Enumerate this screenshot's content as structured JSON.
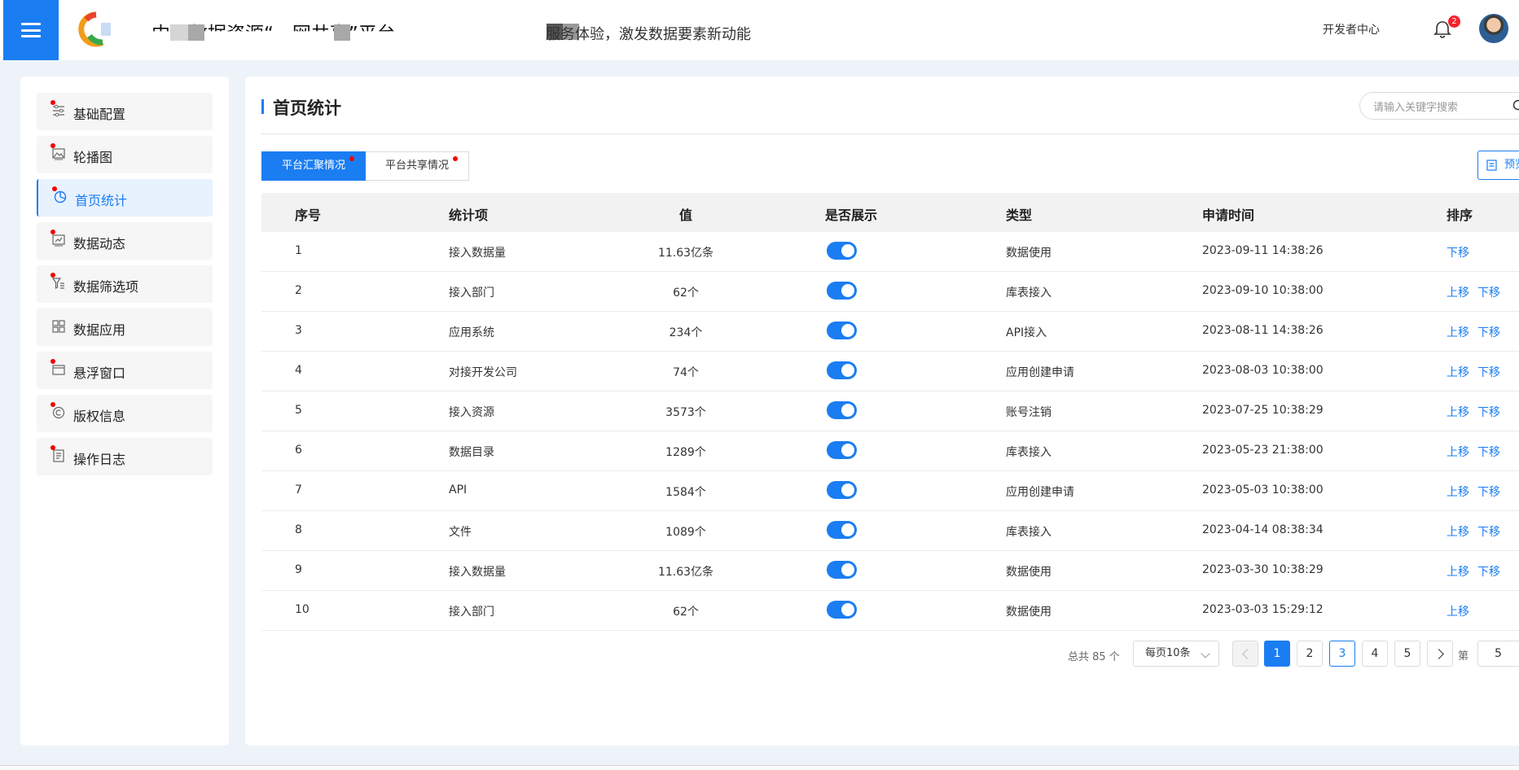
{
  "header": {
    "site_title": "中国数据资源“一网共享”平台",
    "slogan": "服务体验，激发数据要素新动能",
    "developer_center": "开发者中心",
    "notification_count": "2",
    "menu_icon": "hamburger-icon",
    "bell_icon": "bell-icon"
  },
  "sidebar": {
    "items": [
      {
        "label": "基础配置",
        "icon": "sliders-icon"
      },
      {
        "label": "轮播图",
        "icon": "image-icon"
      },
      {
        "label": "首页统计",
        "icon": "pie-chart-icon",
        "active": true
      },
      {
        "label": "数据动态",
        "icon": "chart-icon"
      },
      {
        "label": "数据筛选项",
        "icon": "filter-icon"
      },
      {
        "label": "数据应用",
        "icon": "grid-icon"
      },
      {
        "label": "悬浮窗口",
        "icon": "window-icon"
      },
      {
        "label": "版权信息",
        "icon": "copyright-icon"
      },
      {
        "label": "操作日志",
        "icon": "log-icon"
      }
    ]
  },
  "main": {
    "title": "首页统计",
    "search_placeholder": "请输入关键字搜索",
    "tabs": [
      {
        "label": "平台汇聚情况",
        "active": true
      },
      {
        "label": "平台共享情况",
        "active": false
      }
    ],
    "preview_label": "预览",
    "table": {
      "headers": {
        "no": "序号",
        "item": "统计项",
        "value": "值",
        "show": "是否展示",
        "type": "类型",
        "time": "申请时间",
        "order": "排序"
      },
      "rows": [
        {
          "no": "1",
          "item": "接入数据量",
          "value": "11.63亿条",
          "show": true,
          "type": "数据使用",
          "time": "2023-09-11 14:38:26",
          "up": "",
          "down": "下移"
        },
        {
          "no": "2",
          "item": "接入部门",
          "value": "62个",
          "show": true,
          "type": "库表接入",
          "time": "2023-09-10 10:38:00",
          "up": "上移",
          "down": "下移"
        },
        {
          "no": "3",
          "item": "应用系统",
          "value": "234个",
          "show": true,
          "type": "API接入",
          "time": "2023-08-11 14:38:26",
          "up": "上移",
          "down": "下移"
        },
        {
          "no": "4",
          "item": "对接开发公司",
          "value": "74个",
          "show": true,
          "type": "应用创建申请",
          "time": "2023-08-03 10:38:00",
          "up": "上移",
          "down": "下移"
        },
        {
          "no": "5",
          "item": "接入资源",
          "value": "3573个",
          "show": true,
          "type": "账号注销",
          "time": "2023-07-25 10:38:29",
          "up": "上移",
          "down": "下移"
        },
        {
          "no": "6",
          "item": "数据目录",
          "value": "1289个",
          "show": true,
          "type": "库表接入",
          "time": "2023-05-23 21:38:00",
          "up": "上移",
          "down": "下移"
        },
        {
          "no": "7",
          "item": "API",
          "value": "1584个",
          "show": true,
          "type": "应用创建申请",
          "time": "2023-05-03 10:38:00",
          "up": "上移",
          "down": "下移"
        },
        {
          "no": "8",
          "item": "文件",
          "value": "1089个",
          "show": true,
          "type": "库表接入",
          "time": "2023-04-14 08:38:34",
          "up": "上移",
          "down": "下移"
        },
        {
          "no": "9",
          "item": "接入数据量",
          "value": "11.63亿条",
          "show": true,
          "type": "数据使用",
          "time": "2023-03-30 10:38:29",
          "up": "上移",
          "down": "下移"
        },
        {
          "no": "10",
          "item": "接入部门",
          "value": "62个",
          "show": true,
          "type": "数据使用",
          "time": "2023-03-03 15:29:12",
          "up": "上移",
          "down": ""
        }
      ]
    },
    "pagination": {
      "total": "总共 85 个",
      "page_size": "每页10条",
      "pages": [
        "1",
        "2",
        "3",
        "4",
        "5"
      ],
      "current_page": "1",
      "goto_label": "第",
      "goto_value": "5"
    }
  },
  "colors": {
    "accent": "#1b7df2",
    "badge": "#f5222d",
    "dot": "#f20000"
  }
}
